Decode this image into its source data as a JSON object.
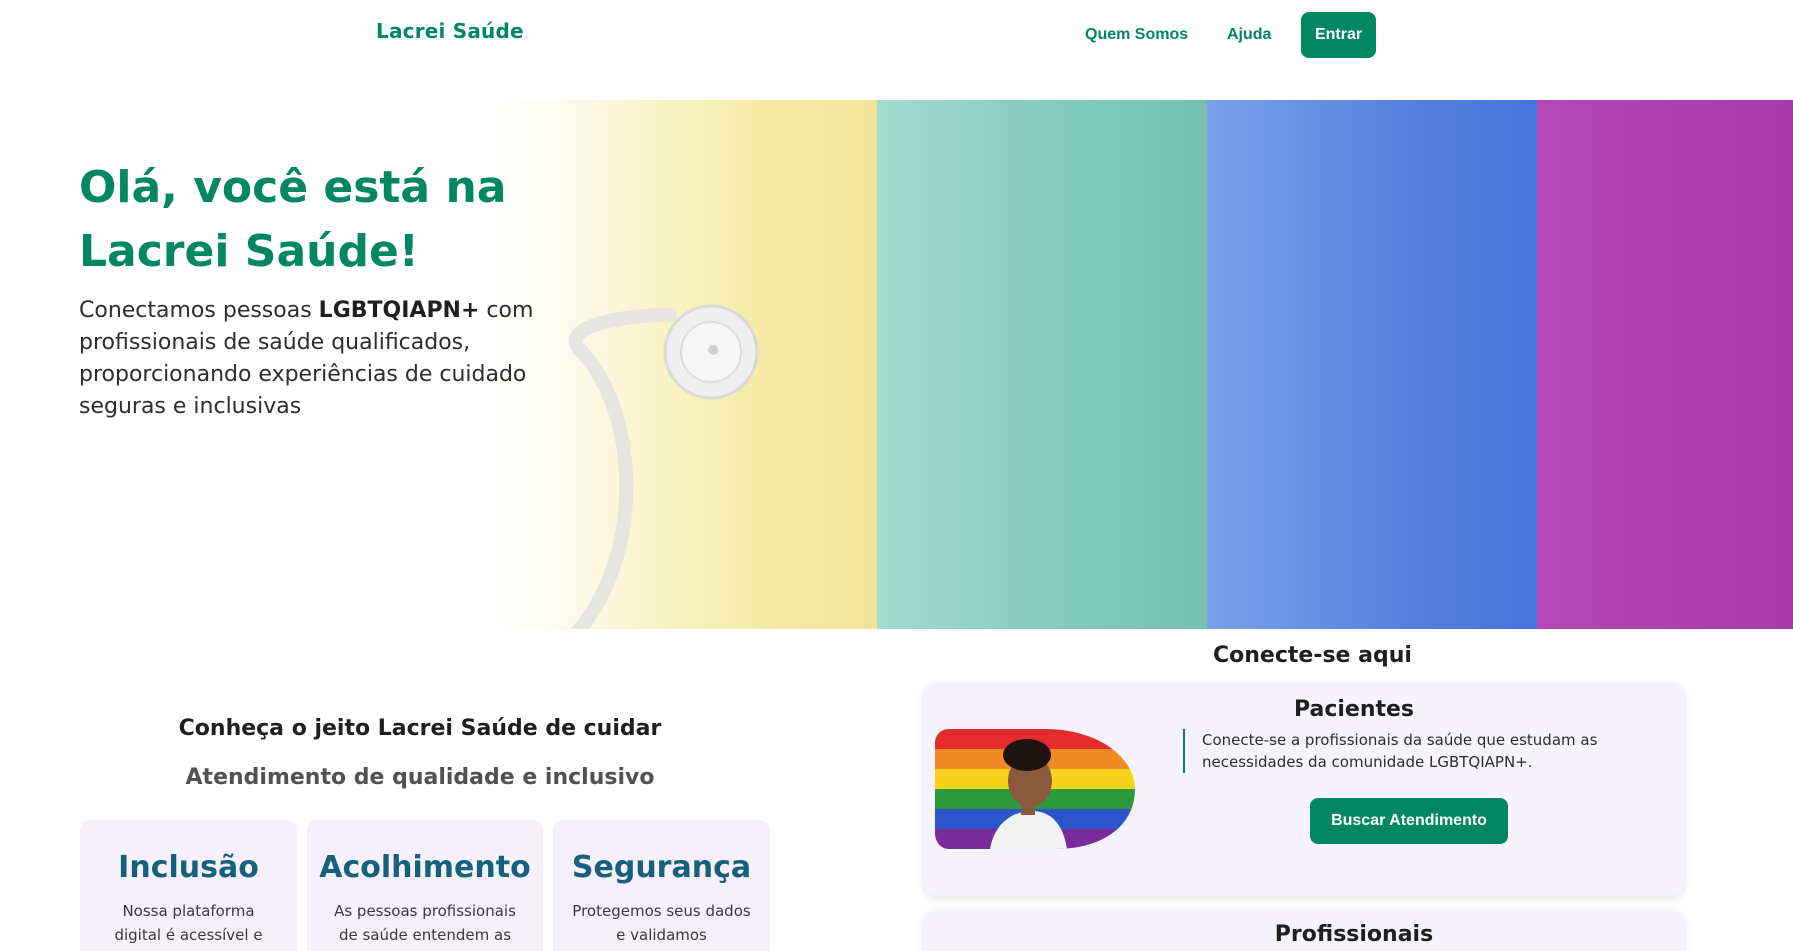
{
  "header": {
    "logo": "Lacrei Saúde",
    "nav": [
      "Quem Somos",
      "Ajuda"
    ],
    "login_label": "Entrar"
  },
  "hero": {
    "title": "Olá, você está na Lacrei Saúde!",
    "text_before": "Conectamos pessoas ",
    "text_bold": "LGBTQIAPN+",
    "text_after": " com profissionais de saúde qualificados, proporcionando experiências de cuidado seguras e inclusivas",
    "image_icon": "stethoscope-on-rainbow-flag"
  },
  "about": {
    "heading": "Conheça o jeito Lacrei Saúde de cuidar",
    "subheading": "Atendimento de qualidade e inclusivo",
    "cards": [
      {
        "title": "Inclusão",
        "text": "Nossa plataforma digital é acessível e"
      },
      {
        "title": "Acolhimento",
        "text": "As pessoas profissionais de saúde entendem as"
      },
      {
        "title": "Segurança",
        "text": "Protegemos seus dados e validamos"
      }
    ]
  },
  "connect": {
    "heading": "Conecte-se aqui",
    "patients": {
      "title": "Pacientes",
      "description": "Conecte-se a profissionais da saúde que estudam as necessidades da comunidade LGBTQIAPN+.",
      "button_label": "Buscar Atendimento",
      "photo_icon": "person-with-rainbow-flag"
    },
    "professionals": {
      "title": "Profissionais"
    }
  },
  "colors": {
    "brand_green": "#018762",
    "card_title_blue": "#15607a",
    "card_bg": "#f5f0fb"
  }
}
